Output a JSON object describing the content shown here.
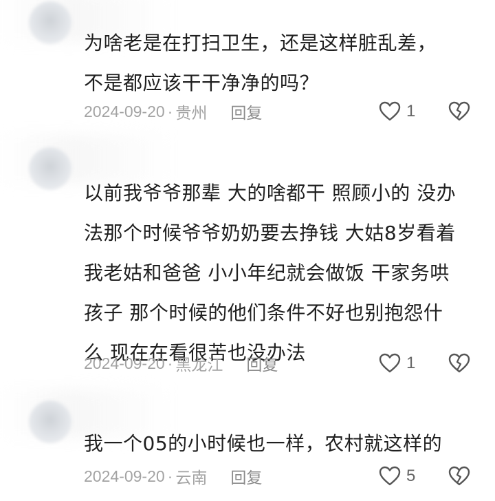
{
  "comments": [
    {
      "text": "为啥老是在打扫卫生，还是这样脏乱差，\n不是都应该干干净净的吗？",
      "date": "2024-09-20",
      "separator": "·",
      "location": "贵州",
      "reply_label": "回复",
      "likes": "1",
      "like_icon": "heart-outline-icon",
      "dislike_icon": "broken-heart-icon"
    },
    {
      "text": "以前我爷爷那辈 大的啥都干 照顾小的 没办\n法那个时候爷爷奶奶要去挣钱 大姑8岁看着\n我老姑和爸爸 小小年纪就会做饭 干家务哄\n孩子 那个时候的他们条件不好也别抱怨什\n么 现在在看很苦也没办法",
      "date": "2024-09-20",
      "separator": "·",
      "location": "黑龙江",
      "reply_label": "回复",
      "likes": "1",
      "like_icon": "heart-outline-icon",
      "dislike_icon": "broken-heart-icon"
    },
    {
      "text": "我一个05的小时候也一样，农村就这样的",
      "date": "2024-09-20",
      "separator": "·",
      "location": "云南",
      "reply_label": "回复",
      "likes": "5",
      "like_icon": "heart-outline-icon",
      "dislike_icon": "broken-heart-icon"
    }
  ],
  "colors": {
    "text": "#1f1f1f",
    "meta": "#a3a3a3",
    "reply": "#8b8b8b",
    "icon": "#555555"
  }
}
